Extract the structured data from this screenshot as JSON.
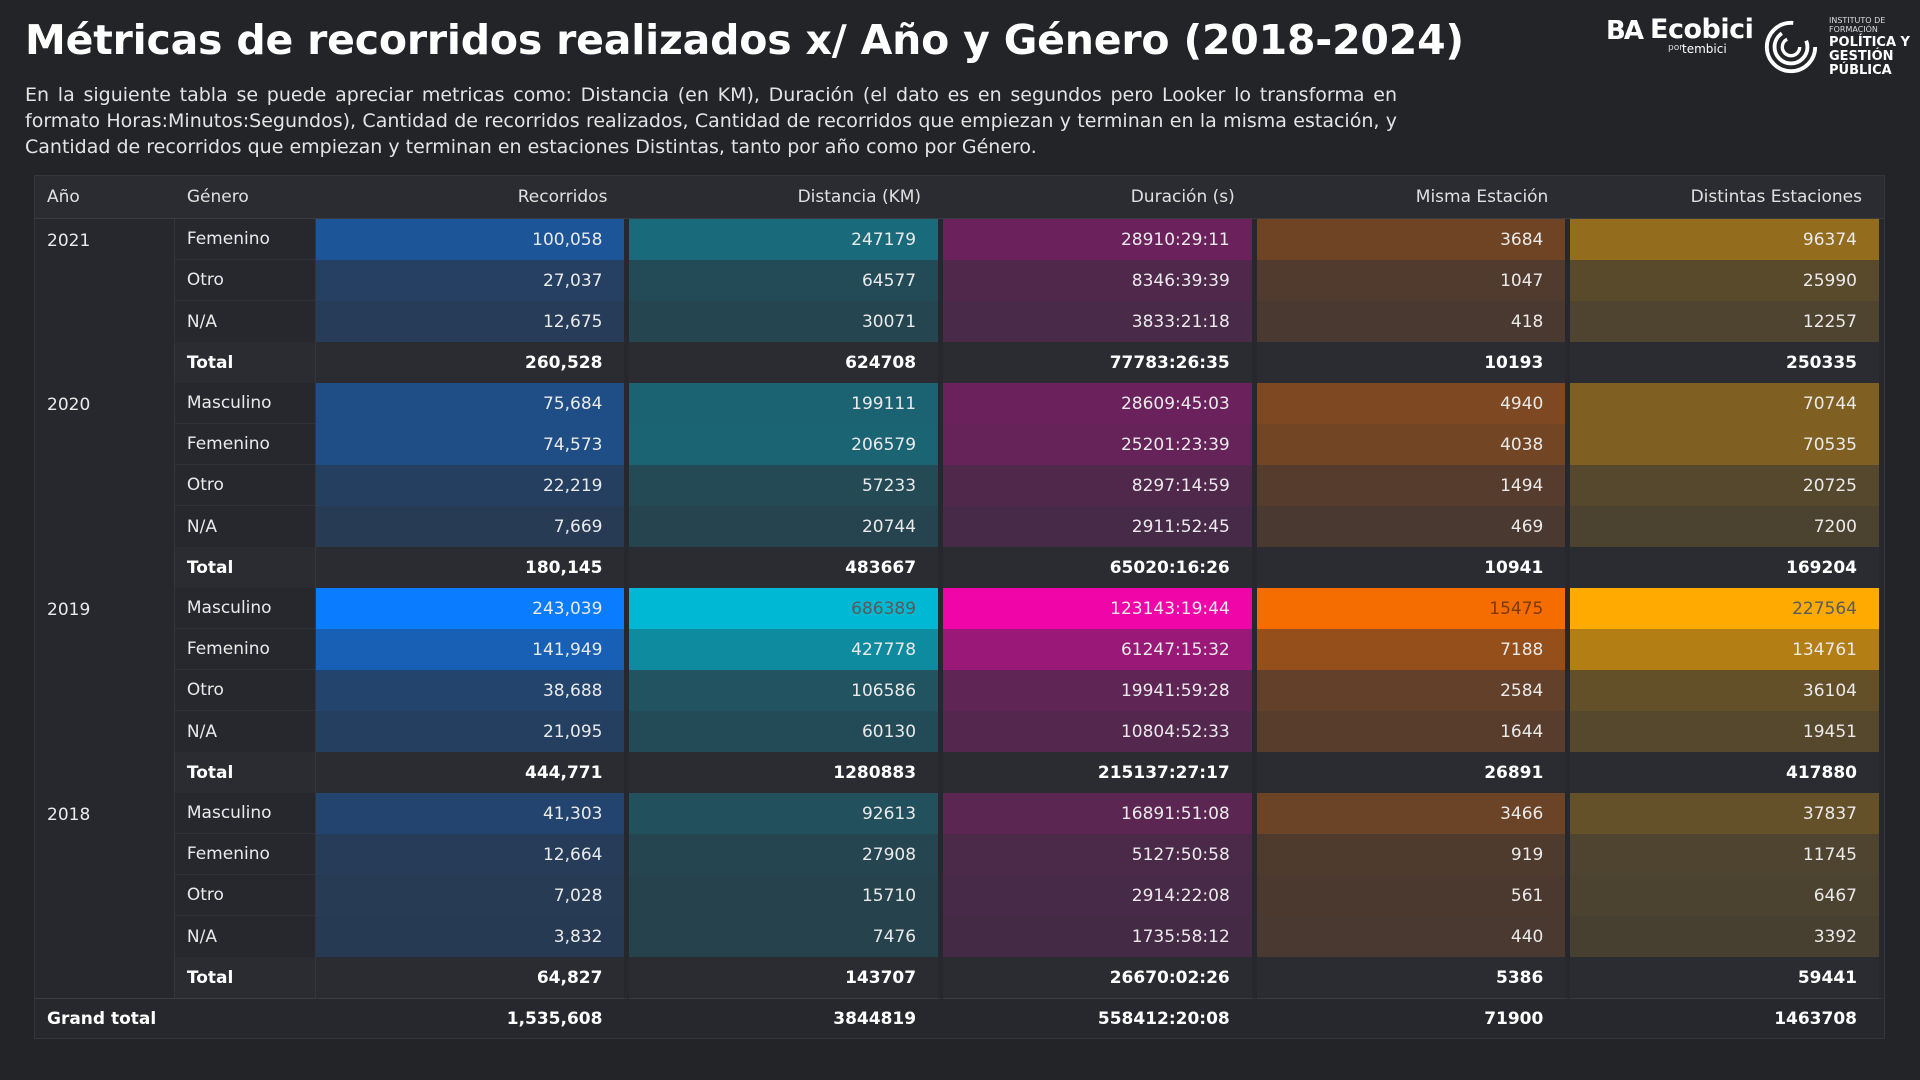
{
  "title": "Métricas de recorridos realizados x/ Año y Género (2018-2024)",
  "description": "En la siguiente tabla se puede apreciar metricas como: Distancia (en KM), Duración (el dato es en segundos pero Looker lo transforma en formato Horas:Minutos:Segundos), Cantidad de recorridos realizados, Cantidad de recorridos que empiezan y terminan en la misma estación, y Cantidad de recorridos que empiezan y terminan en estaciones Distintas, tanto por año como por Género.",
  "logos": {
    "ecobici": {
      "ba": "BA",
      "name": "Ecobici",
      "por": "por",
      "tembici": "tembici"
    },
    "instituto": {
      "small": "INSTITUTO DE FORMACIÓN",
      "big": "POLÍTICA Y GESTIÓN PÚBLICA"
    }
  },
  "colors": {
    "recorridos": "#0a7cff",
    "distancia": "#00b8d4",
    "duracion": "#f005a8",
    "misma": "#f56c00",
    "distintas": "#ffaa00",
    "cell_base": "#2c3038"
  },
  "table": {
    "headers": [
      "Año",
      "Género",
      "Recorridos",
      "Distancia (KM)",
      "Duración (s)",
      "Misma Estación",
      "Distintas Estaciones"
    ],
    "groups": [
      {
        "year": "2021",
        "rows": [
          {
            "gender": "Femenino",
            "values": [
              "100,058",
              "247179",
              "28910:29:11",
              "3684",
              "96374"
            ],
            "intensity": [
              0.41,
              0.36,
              0.23,
              0.24,
              0.42
            ]
          },
          {
            "gender": "Otro",
            "values": [
              "27,037",
              "64577",
              "8346:39:39",
              "1047",
              "25990"
            ],
            "intensity": [
              0.11,
              0.09,
              0.07,
              0.07,
              0.11
            ]
          },
          {
            "gender": "N/A",
            "values": [
              "12,675",
              "30071",
              "3833:21:18",
              "418",
              "12257"
            ],
            "intensity": [
              0.05,
              0.04,
              0.03,
              0.03,
              0.05
            ]
          }
        ],
        "total": {
          "label": "Total",
          "values": [
            "260,528",
            "624708",
            "77783:26:35",
            "10193",
            "250335"
          ]
        }
      },
      {
        "year": "2020",
        "rows": [
          {
            "gender": "Masculino",
            "values": [
              "75,684",
              "199111",
              "28609:45:03",
              "4940",
              "70744"
            ],
            "intensity": [
              0.31,
              0.29,
              0.23,
              0.32,
              0.31
            ]
          },
          {
            "gender": "Femenino",
            "values": [
              "74,573",
              "206579",
              "25201:23:39",
              "4038",
              "70535"
            ],
            "intensity": [
              0.31,
              0.3,
              0.2,
              0.26,
              0.31
            ]
          },
          {
            "gender": "Otro",
            "values": [
              "22,219",
              "57233",
              "8297:14:59",
              "1494",
              "20725"
            ],
            "intensity": [
              0.09,
              0.08,
              0.07,
              0.1,
              0.09
            ]
          },
          {
            "gender": "N/A",
            "values": [
              "7,669",
              "20744",
              "2911:52:45",
              "469",
              "7200"
            ],
            "intensity": [
              0.03,
              0.03,
              0.02,
              0.03,
              0.03
            ]
          }
        ],
        "total": {
          "label": "Total",
          "values": [
            "180,145",
            "483667",
            "65020:16:26",
            "10941",
            "169204"
          ]
        }
      },
      {
        "year": "2019",
        "rows": [
          {
            "gender": "Masculino",
            "values": [
              "243,039",
              "686389",
              "123143:19:44",
              "15475",
              "227564"
            ],
            "intensity": [
              1,
              1,
              1,
              1,
              1
            ]
          },
          {
            "gender": "Femenino",
            "values": [
              "141,949",
              "427778",
              "61247:15:32",
              "7188",
              "134761"
            ],
            "intensity": [
              0.58,
              0.62,
              0.5,
              0.46,
              0.59
            ]
          },
          {
            "gender": "Otro",
            "values": [
              "38,688",
              "106586",
              "19941:59:28",
              "2584",
              "36104"
            ],
            "intensity": [
              0.16,
              0.16,
              0.16,
              0.17,
              0.16
            ]
          },
          {
            "gender": "N/A",
            "values": [
              "21,095",
              "60130",
              "10804:52:33",
              "1644",
              "19451"
            ],
            "intensity": [
              0.09,
              0.09,
              0.09,
              0.11,
              0.09
            ]
          }
        ],
        "total": {
          "label": "Total",
          "values": [
            "444,771",
            "1280883",
            "215137:27:17",
            "26891",
            "417880"
          ]
        }
      },
      {
        "year": "2018",
        "rows": [
          {
            "gender": "Masculino",
            "values": [
              "41,303",
              "92613",
              "16891:51:08",
              "3466",
              "37837"
            ],
            "intensity": [
              0.17,
              0.13,
              0.14,
              0.22,
              0.17
            ]
          },
          {
            "gender": "Femenino",
            "values": [
              "12,664",
              "27908",
              "5127:50:58",
              "919",
              "11745"
            ],
            "intensity": [
              0.05,
              0.04,
              0.04,
              0.06,
              0.05
            ]
          },
          {
            "gender": "Otro",
            "values": [
              "7,028",
              "15710",
              "2914:22:08",
              "561",
              "6467"
            ],
            "intensity": [
              0.03,
              0.02,
              0.02,
              0.04,
              0.03
            ]
          },
          {
            "gender": "N/A",
            "values": [
              "3,832",
              "7476",
              "1735:58:12",
              "440",
              "3392"
            ],
            "intensity": [
              0.02,
              0.01,
              0.01,
              0.03,
              0.01
            ]
          }
        ],
        "total": {
          "label": "Total",
          "values": [
            "64,827",
            "143707",
            "26670:02:26",
            "5386",
            "59441"
          ]
        }
      }
    ],
    "grand_total": {
      "label": "Grand total",
      "values": [
        "1,535,608",
        "3844819",
        "558412:20:08",
        "71900",
        "1463708"
      ]
    }
  }
}
